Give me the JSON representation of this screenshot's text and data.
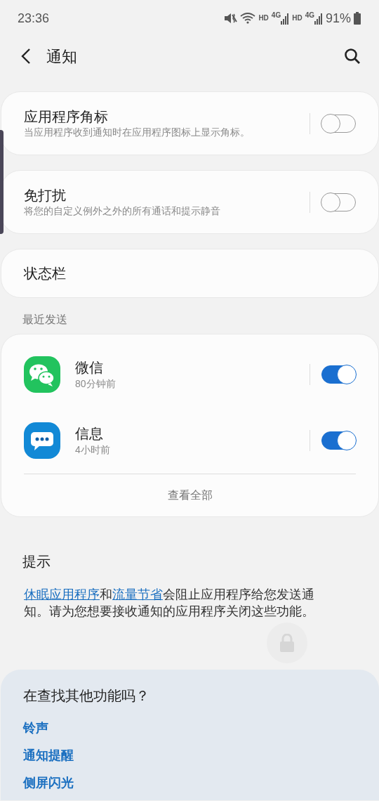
{
  "status_bar": {
    "time": "23:36",
    "networks": [
      {
        "hd": "HD",
        "type": "4G"
      },
      {
        "hd": "HD",
        "type": "4G"
      }
    ],
    "battery_text": "91%"
  },
  "header": {
    "title": "通知"
  },
  "settings": [
    {
      "kind": "toggle",
      "title": "应用程序角标",
      "subtitle": "当应用程序收到通知时在应用程序图标上显示角标。",
      "checked": false
    },
    {
      "kind": "toggle",
      "title": "免打扰",
      "subtitle": "将您的自定义例外之外的所有通话和提示静音",
      "checked": false
    },
    {
      "kind": "plain",
      "title": "状态栏"
    }
  ],
  "recent": {
    "heading": "最近发送",
    "apps": [
      {
        "kind": "wechat",
        "name": "微信",
        "time": "80分钟前",
        "checked": true
      },
      {
        "kind": "messages",
        "name": "信息",
        "time": "4小时前",
        "checked": true
      }
    ],
    "see_all": "查看全部"
  },
  "tip": {
    "title": "提示",
    "parts": [
      {
        "kind": "link",
        "text": "休眠应用程序"
      },
      {
        "kind": "text",
        "text": "和"
      },
      {
        "kind": "link",
        "text": "流量节省"
      },
      {
        "kind": "text",
        "text": "会阻止应用程序给您发送通知。请为您想要接收通知的应用程序关闭这些功能。"
      }
    ]
  },
  "more": {
    "title": "在查找其他功能吗？",
    "links": [
      "铃声",
      "通知提醒",
      "侧屏闪光"
    ]
  }
}
